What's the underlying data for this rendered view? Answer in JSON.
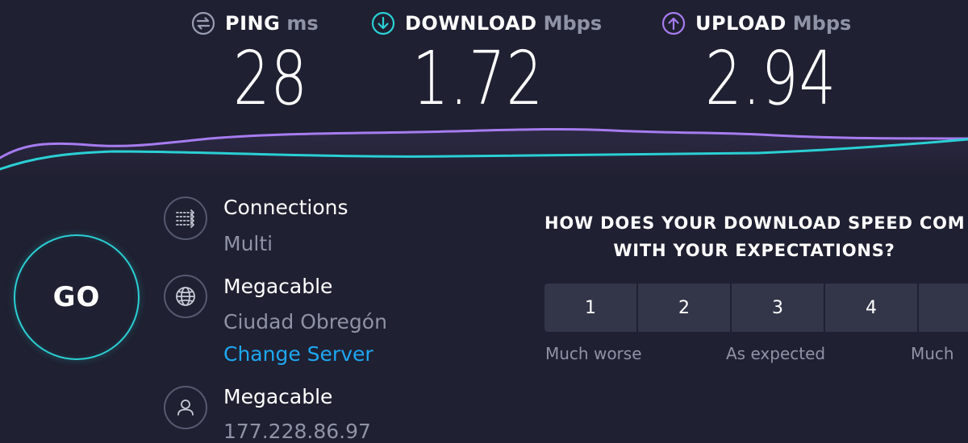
{
  "metrics": {
    "ping": {
      "label": "PING",
      "unit": "ms",
      "value": "28",
      "icon": "ping-icon",
      "color": "#9a9eb3"
    },
    "download": {
      "label": "DOWNLOAD",
      "unit": "Mbps",
      "value": "1.72",
      "icon": "download-arrow-icon",
      "color": "#2ad0d4"
    },
    "upload": {
      "label": "UPLOAD",
      "unit": "Mbps",
      "value": "2.94",
      "icon": "upload-arrow-icon",
      "color": "#a67cf0"
    }
  },
  "graph": {
    "download_color": "#2ad0d4",
    "upload_color": "#a67cf0"
  },
  "go_button": {
    "label": "GO",
    "color": "#2ad0d4"
  },
  "info": {
    "connections": {
      "icon": "connections-icon",
      "title": "Connections",
      "value": "Multi"
    },
    "server": {
      "icon": "globe-icon",
      "title": "Megacable",
      "location": "Ciudad Obregón",
      "change_link": "Change Server"
    },
    "provider": {
      "icon": "user-icon",
      "title": "Megacable",
      "ip": "177.228.86.97"
    }
  },
  "survey": {
    "question_line1": "HOW DOES YOUR DOWNLOAD SPEED COM",
    "question_line2": "WITH YOUR EXPECTATIONS?",
    "ratings": [
      "1",
      "2",
      "3",
      "4",
      ""
    ],
    "captions": {
      "low": "Much worse",
      "mid": "As expected",
      "high": "Much"
    }
  },
  "colors": {
    "background": "#1f2031",
    "accent_cyan": "#2ad0d4",
    "accent_purple": "#a67cf0",
    "link_blue": "#1ea7f2",
    "muted_text": "#8f93a6"
  }
}
